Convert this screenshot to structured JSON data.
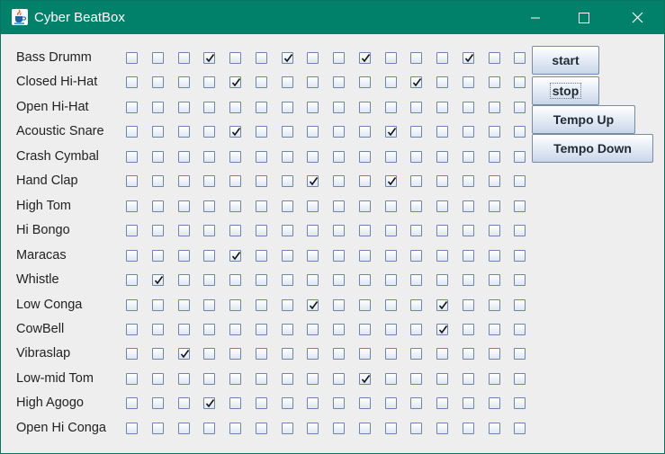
{
  "window": {
    "title": "Cyber BeatBox",
    "icon": "java-cup-icon"
  },
  "controls": {
    "minimize": "minimize-icon",
    "maximize": "maximize-icon",
    "close": "close-icon"
  },
  "colors": {
    "titlebar": "#01806a",
    "background": "#eeeeee",
    "checkbox_border": "#6f85a6"
  },
  "instruments": [
    {
      "name": "Bass Drumm",
      "checked": [
        3,
        6,
        9,
        13
      ]
    },
    {
      "name": "Closed Hi-Hat",
      "checked": [
        4,
        11
      ]
    },
    {
      "name": "Open Hi-Hat",
      "checked": []
    },
    {
      "name": "Acoustic Snare",
      "checked": [
        4,
        10
      ]
    },
    {
      "name": "Crash Cymbal",
      "checked": []
    },
    {
      "name": "Hand Clap",
      "checked": [
        7,
        10
      ]
    },
    {
      "name": "High Tom",
      "checked": []
    },
    {
      "name": "Hi Bongo",
      "checked": []
    },
    {
      "name": "Maracas",
      "checked": [
        4
      ]
    },
    {
      "name": "Whistle",
      "checked": [
        1
      ]
    },
    {
      "name": "Low Conga",
      "checked": [
        7,
        12
      ]
    },
    {
      "name": "CowBell",
      "checked": [
        12
      ]
    },
    {
      "name": "Vibraslap",
      "checked": [
        2
      ]
    },
    {
      "name": "Low-mid Tom",
      "checked": [
        9
      ]
    },
    {
      "name": "High Agogo",
      "checked": [
        3
      ]
    },
    {
      "name": "Open Hi Conga",
      "checked": []
    }
  ],
  "beats_per_row": 16,
  "buttons": {
    "start": "start",
    "stop": "stop",
    "tempo_up": "Tempo Up",
    "tempo_down": "Tempo Down"
  }
}
